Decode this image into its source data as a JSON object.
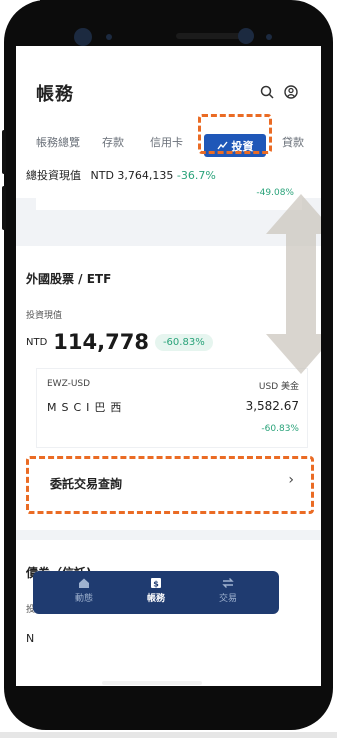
{
  "header": {
    "title": "帳務"
  },
  "tabs": [
    {
      "label": "帳務總覽",
      "active": false
    },
    {
      "label": "存款",
      "active": false
    },
    {
      "label": "信用卡",
      "active": false
    },
    {
      "label": "投資",
      "active": true
    },
    {
      "label": "貸款",
      "active": false
    }
  ],
  "summary": {
    "label": "總投資現值",
    "currency": "NTD",
    "amount": "3,764,135",
    "change": "-36.7%"
  },
  "card1": {
    "change": "-49.08%"
  },
  "foreign": {
    "title": "外國股票 / ETF",
    "value_label": "投資現值",
    "currency": "NTD",
    "amount": "114,778",
    "change": "-60.83%",
    "holding": {
      "code": "EWZ-USD",
      "currency_label": "USD 美金",
      "name": "MSCI巴西",
      "value": "3,582.67",
      "change": "-60.83%"
    },
    "inquiry_label": "委託交易查詢",
    "inquiry_chevron": "›"
  },
  "bonds": {
    "title": "債券（信託)",
    "value_label": "投資現值",
    "currency_partial": "N"
  },
  "nav": [
    {
      "label": "動態",
      "icon": "home-icon",
      "active": false
    },
    {
      "label": "帳務",
      "icon": "dollar-icon",
      "active": true
    },
    {
      "label": "交易",
      "icon": "swap-icon",
      "active": false
    }
  ],
  "colors": {
    "accent": "#1f57b8",
    "positive_green": "#2aa37a",
    "annotation_orange": "#ea6b24",
    "nav_bg": "#1f3b70"
  }
}
